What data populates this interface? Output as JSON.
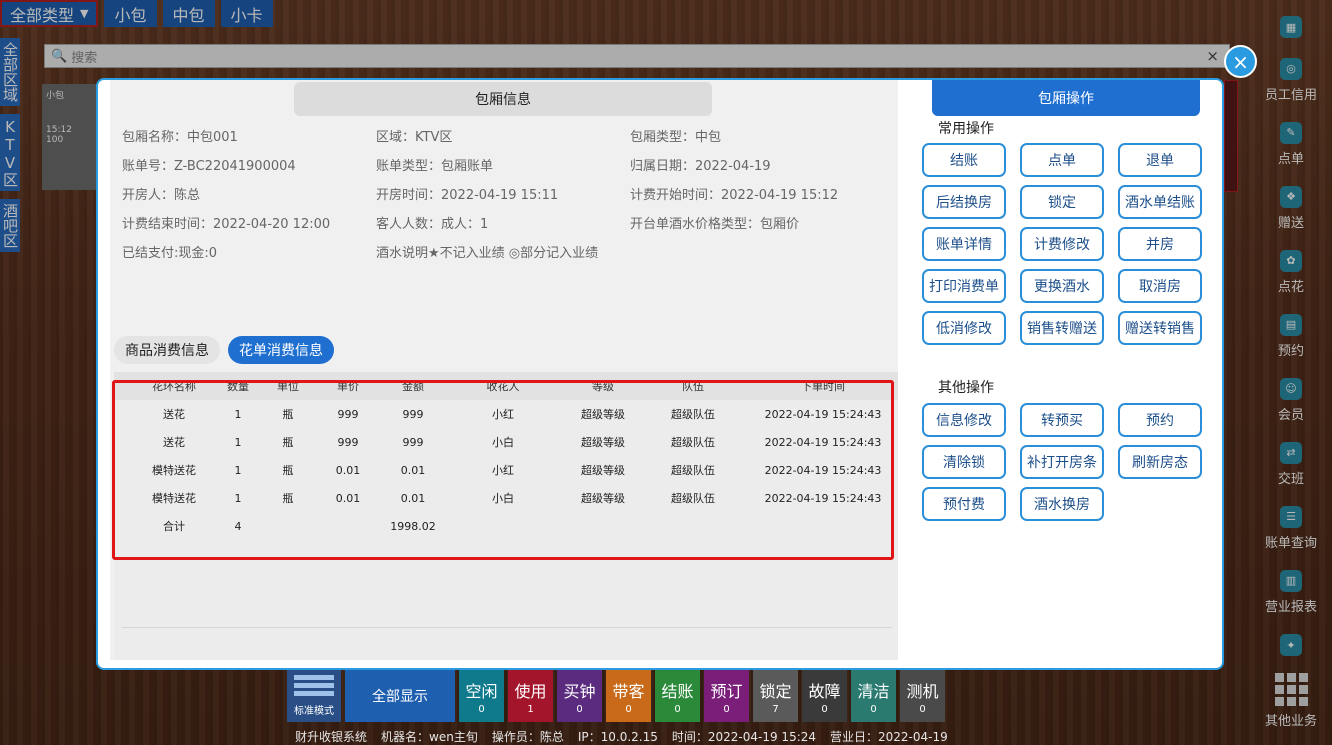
{
  "topbar": {
    "type_select": "全部类型",
    "buttons": [
      "小包",
      "中包",
      "小卡"
    ]
  },
  "area_tabs": [
    "全部区域",
    "KTV区",
    "酒吧区"
  ],
  "search": {
    "placeholder": "搜索"
  },
  "room_card": {
    "name": "小包",
    "time": "15:12",
    "amount": "100"
  },
  "right_sidebar": {
    "items": [
      "员工信用",
      "点单",
      "赠送",
      "点花",
      "预约",
      "会员",
      "交班",
      "账单查询",
      "营业报表",
      "其他业务"
    ]
  },
  "modal": {
    "title": "包厢信息",
    "info": {
      "room_name": "包厢名称：中包001",
      "area": "区域：KTV区",
      "room_type": "包厢类型：中包",
      "bill_no": "账单号：Z-BC22041900004",
      "bill_type": "账单类型：包厢账单",
      "belong_date": "归属日期：2022-04-19",
      "opener": "开房人：陈总",
      "open_time": "开房时间：2022-04-19 15:11",
      "bill_start": "计费开始时间：2022-04-19 15:12",
      "bill_end": "计费结束时间：2022-04-20 12:00",
      "guests": "客人人数：成人：1",
      "price_type": "开台单酒水价格类型：包厢价",
      "paid": "已结支付:现金:0",
      "drink_note": "酒水说明★不记入业绩 ◎部分记入业绩"
    },
    "tabs": {
      "goods": "商品消费信息",
      "flowers": "花单消费信息"
    },
    "table": {
      "headers": [
        "花环名称",
        "数量",
        "单位",
        "单价",
        "金额",
        "收花人",
        "等级",
        "队伍",
        "下单时间"
      ],
      "rows": [
        [
          "送花",
          "1",
          "瓶",
          "999",
          "999",
          "小红",
          "超级等级",
          "超级队伍",
          "2022-04-19 15:24:43"
        ],
        [
          "送花",
          "1",
          "瓶",
          "999",
          "999",
          "小白",
          "超级等级",
          "超级队伍",
          "2022-04-19 15:24:43"
        ],
        [
          "模特送花",
          "1",
          "瓶",
          "0.01",
          "0.01",
          "小红",
          "超级等级",
          "超级队伍",
          "2022-04-19 15:24:43"
        ],
        [
          "模特送花",
          "1",
          "瓶",
          "0.01",
          "0.01",
          "小白",
          "超级等级",
          "超级队伍",
          "2022-04-19 15:24:43"
        ]
      ],
      "total": {
        "label": "合计",
        "qty": "4",
        "amount": "1998.02"
      }
    }
  },
  "ops": {
    "title": "包厢操作",
    "common_label": "常用操作",
    "common": [
      "结账",
      "点单",
      "退单",
      "后结换房",
      "锁定",
      "酒水单结账",
      "账单详情",
      "计费修改",
      "并房",
      "打印消费单",
      "更换酒水",
      "取消房",
      "低消修改",
      "销售转赠送",
      "赠送转销售"
    ],
    "other_label": "其他操作",
    "other": [
      "信息修改",
      "转预买",
      "预约",
      "清除锁",
      "补打开房条",
      "刷新房态",
      "预付费",
      "酒水换房"
    ]
  },
  "bottom_bar": {
    "mode": "标准模式",
    "all": "全部显示",
    "statuses": [
      {
        "label": "空闲",
        "count": "0",
        "color": "#0f7a8c"
      },
      {
        "label": "使用",
        "count": "1",
        "color": "#a3152a"
      },
      {
        "label": "买钟",
        "count": "0",
        "color": "#5a2b7e"
      },
      {
        "label": "带客",
        "count": "0",
        "color": "#c96a1a"
      },
      {
        "label": "结账",
        "count": "0",
        "color": "#2a8a3a"
      },
      {
        "label": "预订",
        "count": "0",
        "color": "#7a1e7a"
      },
      {
        "label": "锁定",
        "count": "7",
        "color": "#5a5a5a"
      },
      {
        "label": "故障",
        "count": "0",
        "color": "#3a3a3a"
      },
      {
        "label": "清洁",
        "count": "0",
        "color": "#2a7a70"
      },
      {
        "label": "测机",
        "count": "0",
        "color": "#4a4a4a"
      }
    ]
  },
  "footer": {
    "system": "财升收银系统",
    "machine": "机器名：wen主旬",
    "operator": "操作员：陈总",
    "ip": "IP：10.0.2.15",
    "time": "时间：2022-04-19 15:24",
    "business_day": "营业日：2022-04-19"
  },
  "colors": {
    "accent": "#1e6fd0",
    "highlight_box": "#e01515",
    "close_button": "#2a9be0"
  }
}
